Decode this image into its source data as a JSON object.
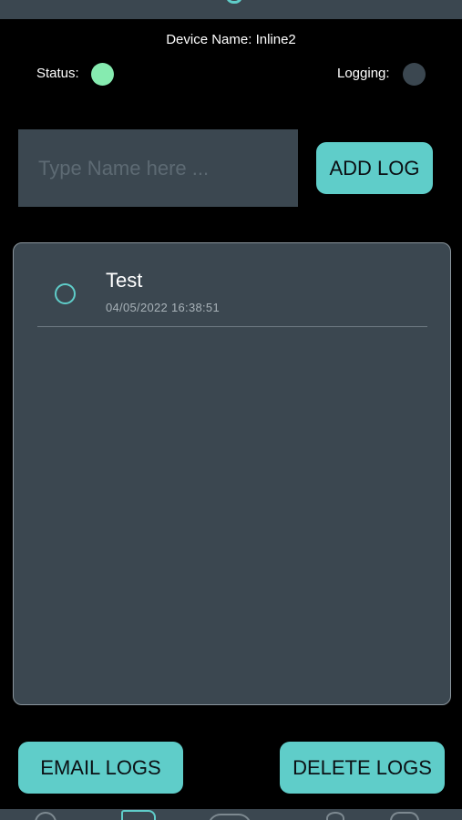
{
  "header": {
    "device_name": "Device Name: Inline2"
  },
  "status": {
    "status_label": "Status:",
    "status_color": "#86ebb0",
    "logging_label": "Logging:",
    "logging_color": "#3b4750"
  },
  "input": {
    "placeholder": "Type Name here ...",
    "value": ""
  },
  "buttons": {
    "add_log": "ADD LOG",
    "email_logs": "EMAIL LOGS",
    "delete_logs": "DELETE LOGS"
  },
  "logs": [
    {
      "name": "Test",
      "date": "04/05/2022 16:38:51",
      "selected": false
    }
  ],
  "bottom_nav": {
    "items": [
      "home-icon",
      "log-document-icon",
      "gauge-icon",
      "gear-icon",
      "tools-icon"
    ],
    "active": "log-document-icon"
  },
  "colors": {
    "accent": "#5fcdc9",
    "panel": "#3b4750",
    "background": "#000000"
  }
}
